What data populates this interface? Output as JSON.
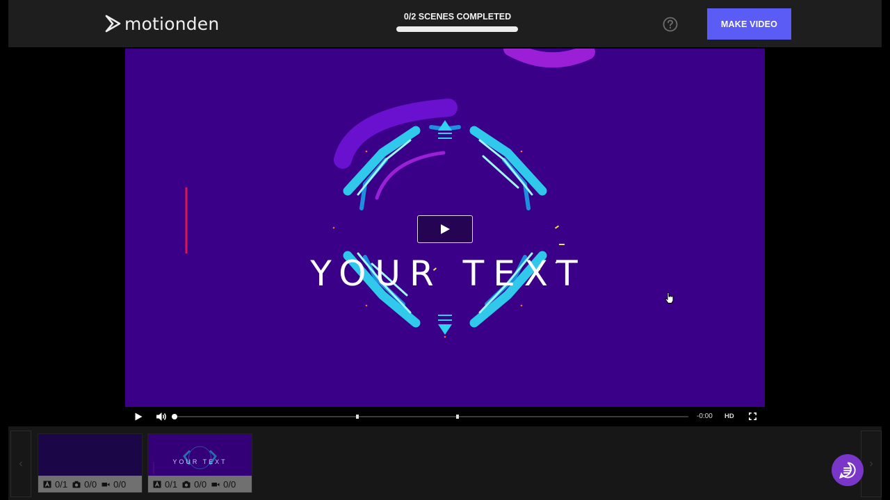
{
  "header": {
    "logo_text": "motionden",
    "progress_label": "0/2 SCENES COMPLETED",
    "progress_fraction": 0,
    "make_video_label": "MAKE VIDEO"
  },
  "video": {
    "overlay_text": "YOUR TEXT",
    "colors": {
      "background": "#3a0087",
      "accent_cyan": "#2fd3f0",
      "accent_magenta": "#9a1fd6"
    }
  },
  "player": {
    "time_remaining": "-0:00",
    "quality_label": "HD",
    "progress_fraction": 0
  },
  "scenes": [
    {
      "thumb_text": "",
      "stats": {
        "text": "0/1",
        "photo": "0/0",
        "video": "0/0"
      }
    },
    {
      "thumb_text": "YOUR TEXT",
      "stats": {
        "text": "0/1",
        "photo": "0/0",
        "video": "0/0"
      }
    }
  ],
  "icons": {
    "logo": "play-outline-icon",
    "help": "question-circle-icon",
    "play": "play-icon",
    "volume": "volume-icon",
    "fullscreen": "fullscreen-icon",
    "chat": "chat-icon"
  }
}
